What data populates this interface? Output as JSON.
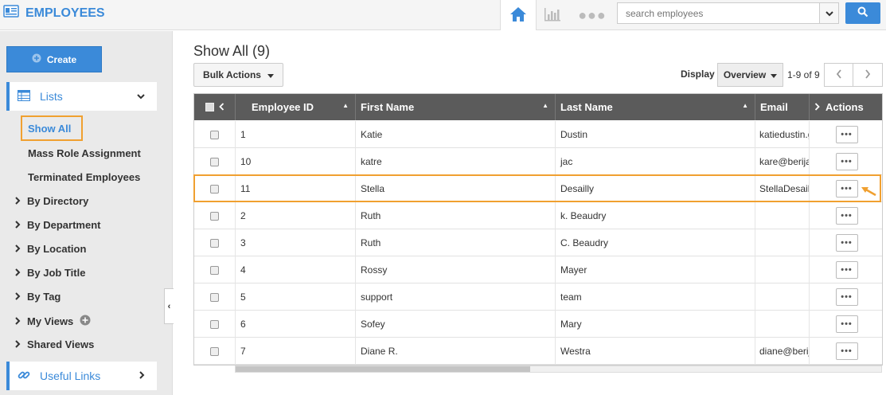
{
  "app": {
    "title": "EMPLOYEES"
  },
  "search": {
    "placeholder": "search employees"
  },
  "sidebar": {
    "create_label": "Create",
    "lists_label": "Lists",
    "list_items": [
      "Show All",
      "Mass Role Assignment",
      "Terminated Employees"
    ],
    "groups": [
      "By Directory",
      "By Department",
      "By Location",
      "By Job Title",
      "By Tag",
      "My Views",
      "Shared Views"
    ],
    "useful_links_label": "Useful Links"
  },
  "main": {
    "title": "Show All (9)",
    "bulk_actions_label": "Bulk Actions",
    "display_label": "Display",
    "display_value": "Overview",
    "pager_text": "1-9 of 9"
  },
  "table": {
    "columns": [
      "Employee ID",
      "First Name",
      "Last Name",
      "Email",
      "Actions"
    ],
    "rows": [
      {
        "id": "1",
        "first": "Katie",
        "last": "Dustin",
        "email": "katiedustin.g"
      },
      {
        "id": "10",
        "first": "katre",
        "last": "jac",
        "email": "kare@berija"
      },
      {
        "id": "11",
        "first": "Stella",
        "last": "Desailly",
        "email": "StellaDesail"
      },
      {
        "id": "2",
        "first": "Ruth",
        "last": "k. Beaudry",
        "email": ""
      },
      {
        "id": "3",
        "first": "Ruth",
        "last": "C. Beaudry",
        "email": ""
      },
      {
        "id": "4",
        "first": "Rossy",
        "last": "Mayer",
        "email": ""
      },
      {
        "id": "5",
        "first": "support",
        "last": "team",
        "email": ""
      },
      {
        "id": "6",
        "first": "Sofey",
        "last": "Mary",
        "email": ""
      },
      {
        "id": "7",
        "first": "Diane R.",
        "last": "Westra",
        "email": "diane@berij"
      }
    ],
    "highlighted_row_index": 2
  },
  "colors": {
    "accent": "#3b8ad9",
    "highlight": "#f0a030",
    "header_bg": "#5b5b5b"
  },
  "icons": {
    "app": "id-card-icon",
    "home": "home-icon",
    "chart": "bar-chart-icon",
    "more": "more-dots-icon",
    "search": "search-icon"
  }
}
